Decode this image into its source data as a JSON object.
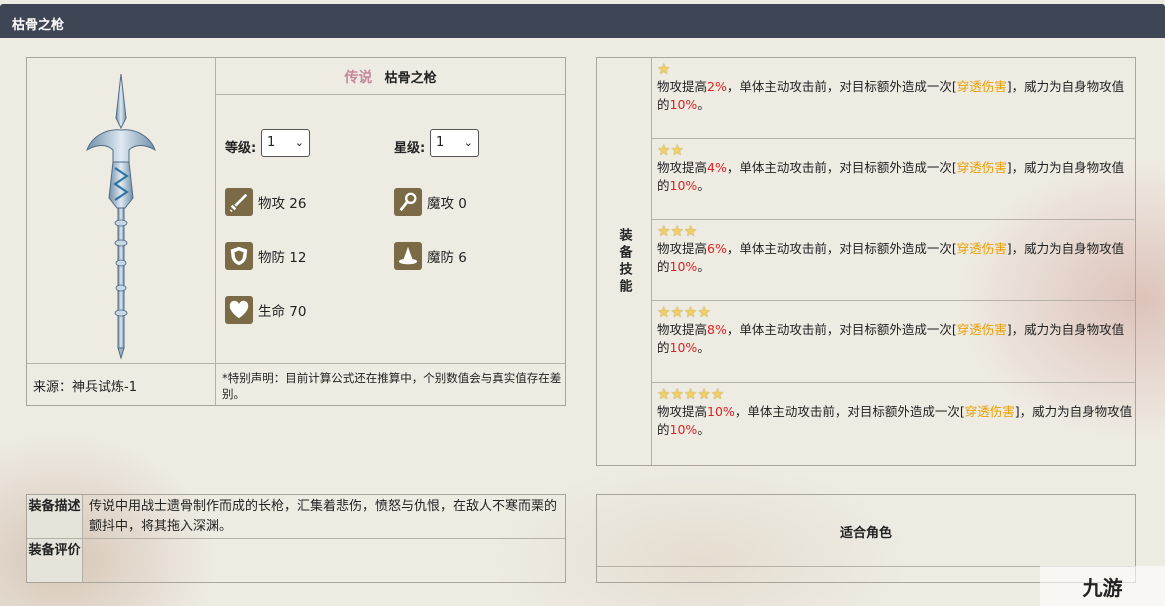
{
  "header": {
    "title": "枯骨之枪"
  },
  "item": {
    "rarity": "传说",
    "name": "枯骨之枪",
    "level_label": "等级:",
    "level_value": "1",
    "star_label": "星级:",
    "star_value": "1",
    "stats": [
      {
        "icon": "sword-icon",
        "label": "物攻 26"
      },
      {
        "icon": "staff-icon",
        "label": "魔攻 0"
      },
      {
        "icon": "shield-icon",
        "label": "物防 12"
      },
      {
        "icon": "wizard-hat-icon",
        "label": "魔防 6"
      },
      {
        "icon": "heart-icon",
        "label": "生命 70"
      }
    ],
    "source": "来源：神兵试炼-1",
    "note": "*特别声明：目前计算公式还在推算中，个别数值会与真实值存在差别。"
  },
  "skills": {
    "label": "装备技能",
    "rows": [
      {
        "stars": 1,
        "pre": "物攻提高",
        "pct": "2%",
        "mid": "，单体主动攻击前，对目标额外造成一次[",
        "tag": "穿透伤害",
        "post": "]，威力为自身物攻值的",
        "power": "10%",
        "end": "。"
      },
      {
        "stars": 2,
        "pre": "物攻提高",
        "pct": "4%",
        "mid": "，单体主动攻击前，对目标额外造成一次[",
        "tag": "穿透伤害",
        "post": "]，威力为自身物攻值的",
        "power": "10%",
        "end": "。"
      },
      {
        "stars": 3,
        "pre": "物攻提高",
        "pct": "6%",
        "mid": "，单体主动攻击前，对目标额外造成一次[",
        "tag": "穿透伤害",
        "post": "]，威力为自身物攻值的",
        "power": "10%",
        "end": "。"
      },
      {
        "stars": 4,
        "pre": "物攻提高",
        "pct": "8%",
        "mid": "，单体主动攻击前，对目标额外造成一次[",
        "tag": "穿透伤害",
        "post": "]，威力为自身物攻值的",
        "power": "10%",
        "end": "。"
      },
      {
        "stars": 5,
        "pre": "物攻提高",
        "pct": "10%",
        "mid": "，单体主动攻击前，对目标额外造成一次[",
        "tag": "穿透伤害",
        "post": "]，威力为自身物攻值的",
        "power": "10%",
        "end": "。"
      }
    ]
  },
  "description": {
    "desc_label": "装备描述",
    "desc_text": "传说中用战士遗骨制作而成的长枪，汇集着悲伤，愤怒与仇恨，在敌人不寒而栗的颤抖中，将其拖入深渊。",
    "review_label": "装备评价",
    "review_text": ""
  },
  "roles": {
    "title": "适合角色"
  },
  "watermark": {
    "text": "九游"
  },
  "colors": {
    "header_bg": "#3e4655",
    "highlight_red": "#e02020",
    "highlight_gold": "#e8a000",
    "rarity": "#c3899a"
  }
}
